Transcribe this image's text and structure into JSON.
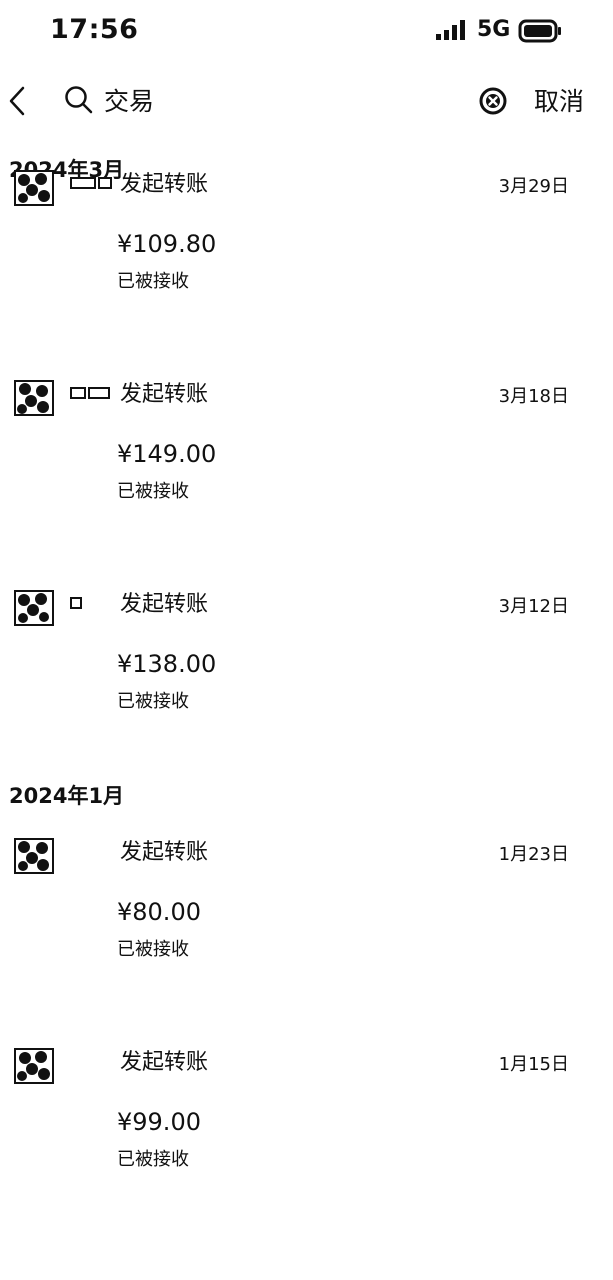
{
  "status_bar": {
    "time": "17:56",
    "network": "5G"
  },
  "search": {
    "query": "交易"
  },
  "header": {
    "cancel_label": "取消"
  },
  "groups": [
    {
      "month": "2024年3月",
      "transactions": [
        {
          "title": "发起转账",
          "date": "3月29日",
          "amount": "¥109.80",
          "status": "已被接收"
        },
        {
          "title": "发起转账",
          "date": "3月18日",
          "amount": "¥149.00",
          "status": "已被接收"
        },
        {
          "title": "发起转账",
          "date": "3月12日",
          "amount": "¥138.00",
          "status": "已被接收"
        }
      ]
    },
    {
      "month": "2024年1月",
      "transactions": [
        {
          "title": "发起转账",
          "date": "1月23日",
          "amount": "¥80.00",
          "status": "已被接收"
        },
        {
          "title": "发起转账",
          "date": "1月15日",
          "amount": "¥99.00",
          "status": "已被接收"
        }
      ]
    }
  ],
  "icons": {
    "status_bar": [
      "signal-icon",
      "battery-icon"
    ],
    "header": [
      "back-arrow-icon",
      "search-icon",
      "clear-icon"
    ],
    "rows": [
      "avatar-icon"
    ]
  }
}
